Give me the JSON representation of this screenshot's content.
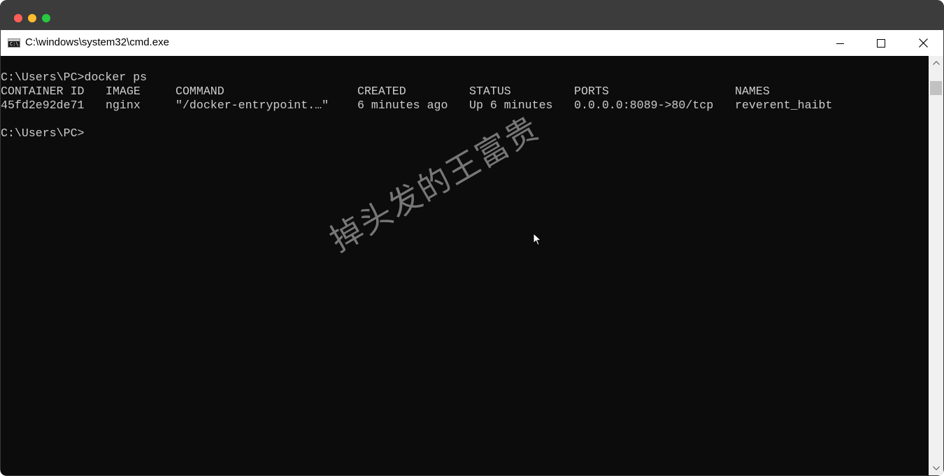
{
  "window": {
    "title": "C:\\windows\\system32\\cmd.exe",
    "icon": "cmd-icon",
    "controls": [
      "minimize-icon",
      "maximize-icon",
      "close-icon"
    ]
  },
  "console": {
    "prompt1": "C:\\Users\\PC>docker ps",
    "headers": {
      "container_id": "CONTAINER ID",
      "image": "IMAGE",
      "command": "COMMAND",
      "created": "CREATED",
      "status": "STATUS",
      "ports": "PORTS",
      "names": "NAMES"
    },
    "rows": [
      {
        "container_id": "45fd2e92de71",
        "image": "nginx",
        "command": "\"/docker-entrypoint.…\"",
        "created": "6 minutes ago",
        "status": "Up 6 minutes",
        "ports": "0.0.0.0:8089->80/tcp",
        "names": "reverent_haibt"
      }
    ],
    "prompt2": "C:\\Users\\PC>"
  },
  "watermark": "掉头发的王富贵",
  "colors": {
    "console_bg": "#0c0c0c",
    "console_fg": "#cccccc",
    "mac_red": "#ff5f57",
    "mac_yellow": "#febc2e",
    "mac_green": "#28c840"
  }
}
